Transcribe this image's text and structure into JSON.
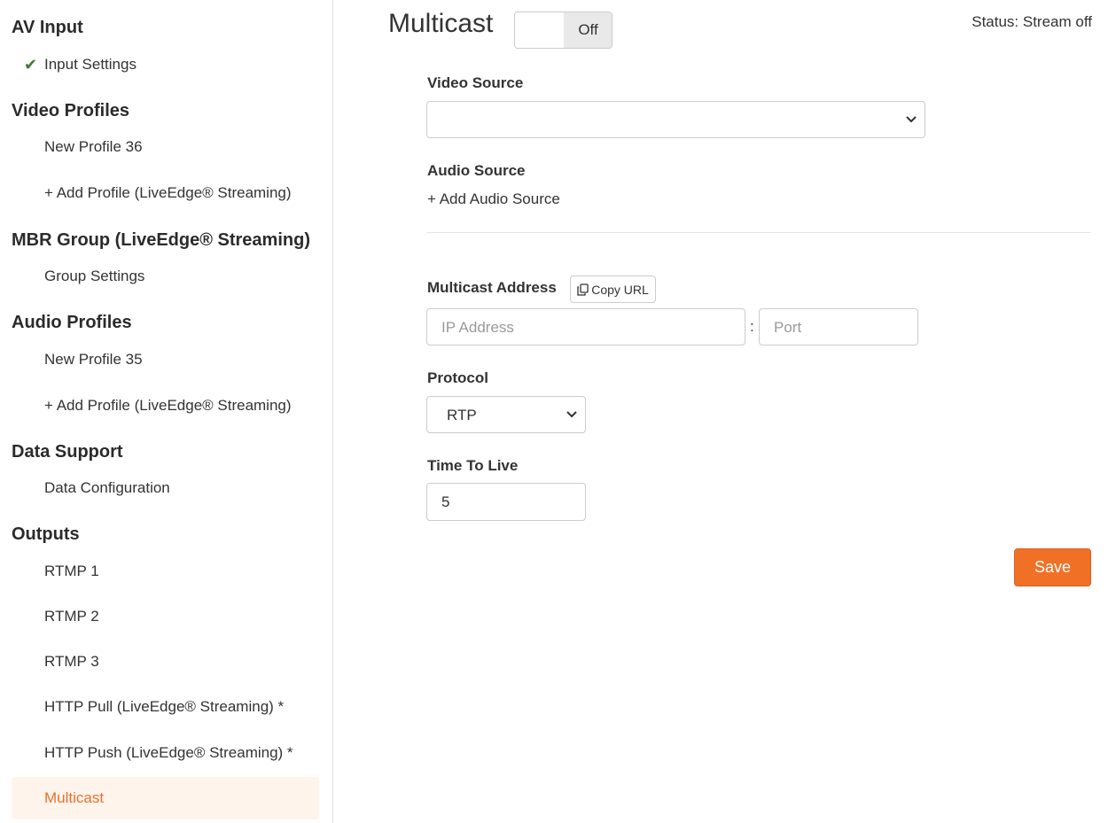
{
  "sidebar": {
    "sections": [
      {
        "title": "AV Input",
        "items": [
          {
            "label": "Input Settings",
            "checked": true
          }
        ]
      },
      {
        "title": "Video Profiles",
        "items": [
          {
            "label": "New Profile 36"
          },
          {
            "label": "+ Add Profile (LiveEdge® Streaming)"
          }
        ]
      },
      {
        "title": "MBR Group (LiveEdge® Streaming)",
        "items": [
          {
            "label": "Group Settings"
          }
        ]
      },
      {
        "title": "Audio Profiles",
        "items": [
          {
            "label": "New Profile 35"
          },
          {
            "label": "+ Add Profile (LiveEdge® Streaming)"
          }
        ]
      },
      {
        "title": "Data Support",
        "items": [
          {
            "label": "Data Configuration"
          }
        ]
      },
      {
        "title": "Outputs",
        "items": [
          {
            "label": "RTMP 1"
          },
          {
            "label": "RTMP 2"
          },
          {
            "label": "RTMP 3"
          },
          {
            "label": "HTTP Pull (LiveEdge® Streaming) *"
          },
          {
            "label": "HTTP Push (LiveEdge® Streaming) *"
          },
          {
            "label": "Multicast",
            "active": true
          }
        ]
      }
    ]
  },
  "header": {
    "title": "Multicast",
    "toggle_label": "Off",
    "status": "Status: Stream off"
  },
  "form": {
    "video_source": {
      "label": "Video Source",
      "value": ""
    },
    "audio_source": {
      "label": "Audio Source",
      "add_label": "+ Add Audio Source"
    },
    "multicast_address": {
      "label": "Multicast Address",
      "copy_label": "Copy URL",
      "ip_placeholder": "IP Address",
      "port_placeholder": "Port",
      "separator": ":"
    },
    "protocol": {
      "label": "Protocol",
      "value": "RTP"
    },
    "ttl": {
      "label": "Time To Live",
      "value": "5"
    },
    "save_label": "Save"
  },
  "colors": {
    "accent": "#f07126",
    "active_bg": "#fff4ec",
    "check": "#3d7a3d"
  },
  "icons": {
    "check": "check-icon",
    "chevron": "chevron-down-icon",
    "copy": "copy-icon"
  }
}
